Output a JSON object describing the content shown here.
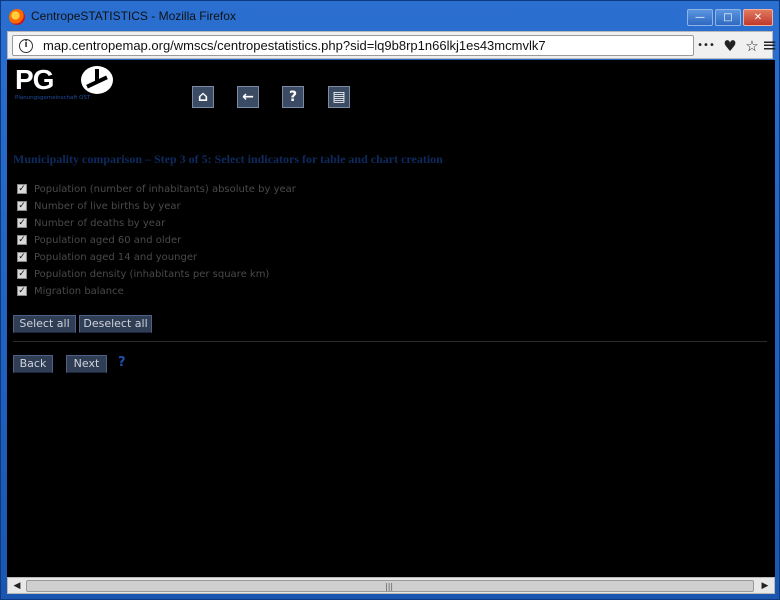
{
  "window": {
    "title": "CentropeSTATISTICS - Mozilla Firefox",
    "minimize": "—",
    "maximize": "□",
    "close": "✕"
  },
  "navbar": {
    "url": "map.centropemap.org/wmscs/centropestatistics.php?sid=lq9b8rp1n66lkj1es43mcmvlk7",
    "info_icon": "i",
    "more_icon": "•••",
    "pocket_icon": "♥",
    "bookmark_icon": "☆",
    "menu_icon": "≡"
  },
  "logo": {
    "letters": "PG",
    "subtitle": "Planungsgemeinschaft OST"
  },
  "toolbar": {
    "home_icon": "⌂",
    "back_icon": "←",
    "help_icon": "?",
    "calc_icon": "▤"
  },
  "heading": "Municipality comparison – Step 3 of 5: Select indicators for table and chart creation",
  "indicators": [
    {
      "label": "Population (number of inhabitants) absolute by year",
      "checked": true
    },
    {
      "label": "Number of live births by year",
      "checked": true
    },
    {
      "label": "Number of deaths by year",
      "checked": true
    },
    {
      "label": "Population aged 60 and older",
      "checked": true
    },
    {
      "label": "Population aged 14 and younger",
      "checked": true
    },
    {
      "label": "Population density (inhabitants per square km)",
      "checked": true
    },
    {
      "label": "Migration balance",
      "checked": true
    }
  ],
  "check_mark": "✓",
  "buttons": {
    "select_all": "Select all",
    "deselect_all": "Deselect all",
    "back": "Back",
    "next": "Next",
    "help": "?"
  },
  "scrollbar": {
    "left": "◀",
    "right": "▶",
    "grip": "|||"
  }
}
